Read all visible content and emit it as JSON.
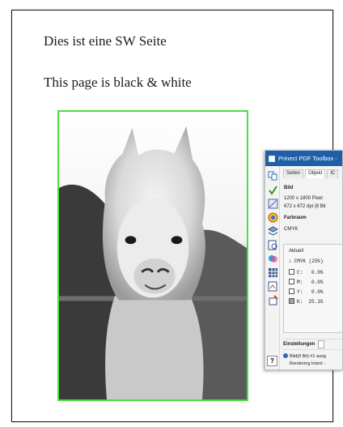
{
  "document": {
    "line_de": "Dies ist eine SW Seite",
    "line_en": "This page is black & white"
  },
  "toolbox": {
    "title": "Prinect PDF Toolbox -",
    "tabs": [
      "Seiten",
      "Objekt",
      "IC"
    ],
    "active_tab": "Objekt",
    "bild_heading": "Bild",
    "pixel_size": "1200 x 1800 Pixel",
    "resolution": "672 x 672 dpi (8 Bit",
    "farbraum_heading": "Farbraum",
    "farbraum_value": "CMYK",
    "aktuell_label": "Aktuell",
    "cmyk_summary": "CMYK (25%)",
    "channels": [
      {
        "label": "C:",
        "value": "0.0%"
      },
      {
        "label": "M:",
        "value": "0.0%"
      },
      {
        "label": "Y:",
        "value": "0.0%"
      },
      {
        "label": "K:",
        "value": "25.1%"
      }
    ],
    "einstellungen_label": "Einstellungen",
    "status_line1": "Bild(8 Bit) #1 ausg",
    "status_line2": "Rendering Intent :",
    "help_label": "?"
  },
  "colors": {
    "title_bar": "#1f5fa8",
    "image_border": "#4cde3f"
  }
}
